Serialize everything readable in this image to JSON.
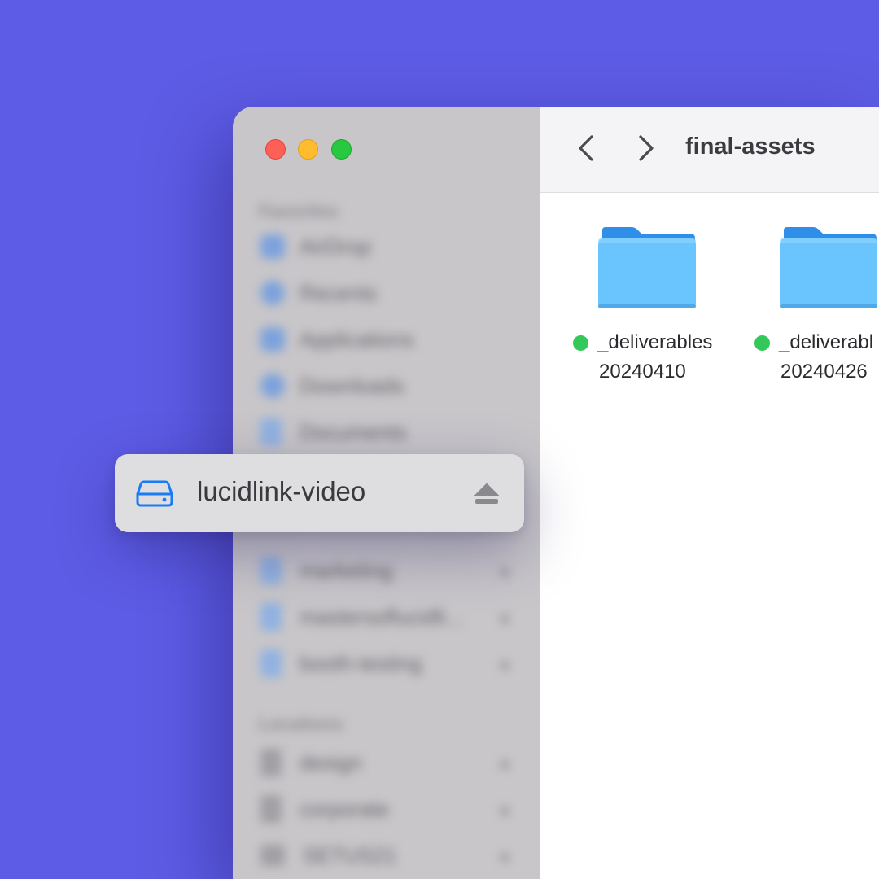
{
  "window": {
    "toolbar": {
      "back_icon": "chevron-left-icon",
      "forward_icon": "chevron-right-icon",
      "title": "final-assets"
    },
    "sidebar": {
      "favorites_title": "Favorites",
      "favorites": [
        {
          "label": "AirDrop",
          "icon": "airdrop-icon"
        },
        {
          "label": "Recents",
          "icon": "clock-icon"
        },
        {
          "label": "Applications",
          "icon": "applications-icon"
        },
        {
          "label": "Downloads",
          "icon": "download-icon"
        },
        {
          "label": "Documents",
          "icon": "document-icon"
        }
      ],
      "shared": [
        {
          "label": "marketing",
          "icon": "shared-folder-icon"
        },
        {
          "label": "mastersoflucidli...",
          "icon": "shared-folder-icon"
        },
        {
          "label": "booth-testing",
          "icon": "shared-folder-icon"
        }
      ],
      "locations_title": "Locations",
      "locations": [
        {
          "label": "design",
          "icon": "drive-icon"
        },
        {
          "label": "corporate",
          "icon": "drive-icon"
        },
        {
          "label": "SETUS21",
          "icon": "computer-icon"
        }
      ]
    },
    "files": [
      {
        "name": "_deliverables",
        "date": "20240410",
        "tag_color": "#34c759"
      },
      {
        "name": "_deliverabl",
        "date": "20240426",
        "tag_color": "#34c759"
      }
    ]
  },
  "highlight": {
    "label": "lucidlink-video",
    "icon": "external-drive-icon",
    "eject_icon": "eject-icon",
    "accent": "#1a7cf5"
  },
  "colors": {
    "background": "#5d5ce6",
    "folder": "#6ac4fd",
    "tag_green": "#34c759"
  }
}
